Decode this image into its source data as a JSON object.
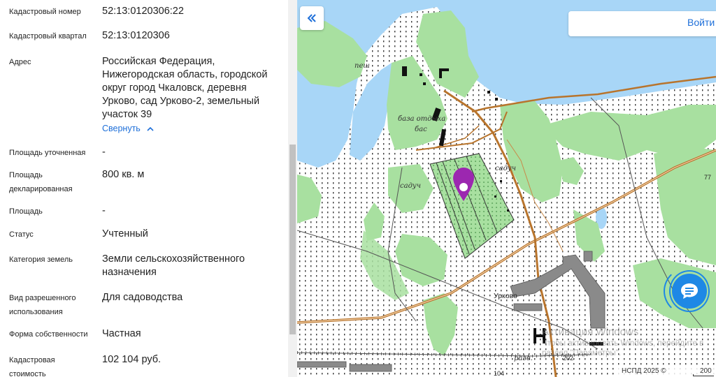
{
  "panel": {
    "fields": [
      {
        "label": "Кадастровый номер",
        "value": "52:13:0120306:22"
      },
      {
        "label": "Кадастровый квартал",
        "value": "52:13:0120306"
      },
      {
        "label": "Адрес",
        "value": "Российская Федерация, Нижегородская область, городской округ город Чкаловск, деревня Урково, сад Урково-2, земельный участок 39"
      },
      {
        "label": "Площадь уточненная",
        "value": "-"
      },
      {
        "label": "Площадь декларированная",
        "value": "800 кв. м"
      },
      {
        "label": "Площадь",
        "value": "-"
      },
      {
        "label": "Статус",
        "value": "Учтенный"
      },
      {
        "label": "Категория земель",
        "value": "Земли сельскохозяйственного назначения"
      },
      {
        "label": "Вид разрешенного использования",
        "value": "Для садоводства"
      },
      {
        "label": "Форма собственности",
        "value": "Частная"
      },
      {
        "label": "Кадастровая стоимость",
        "value": "102 104 руб."
      }
    ],
    "collapse_link": "Свернуть"
  },
  "map": {
    "login_button": "Войти",
    "labels": {
      "pesh": "пеш",
      "baza": "база отдыха",
      "bas": "бас",
      "saduch_left": "садуч",
      "saduch_right": "садуч",
      "urkovo": "Урково",
      "razv": "разв.",
      "num_77": "77",
      "num_104": "104",
      "num_202": "202"
    },
    "watermark_title": "Активация Windows",
    "watermark_text": "Чтобы активировать Windows, перейдите в раздел \"Параметры\".",
    "attribution": "НСПД 2025 ©",
    "scale_label": "200",
    "colors": {
      "water": "#a8d6f7",
      "forest": "#a8e0a0",
      "road": "#b8742c",
      "accent": "#1e88e5",
      "marker": "#9c27b0"
    }
  }
}
